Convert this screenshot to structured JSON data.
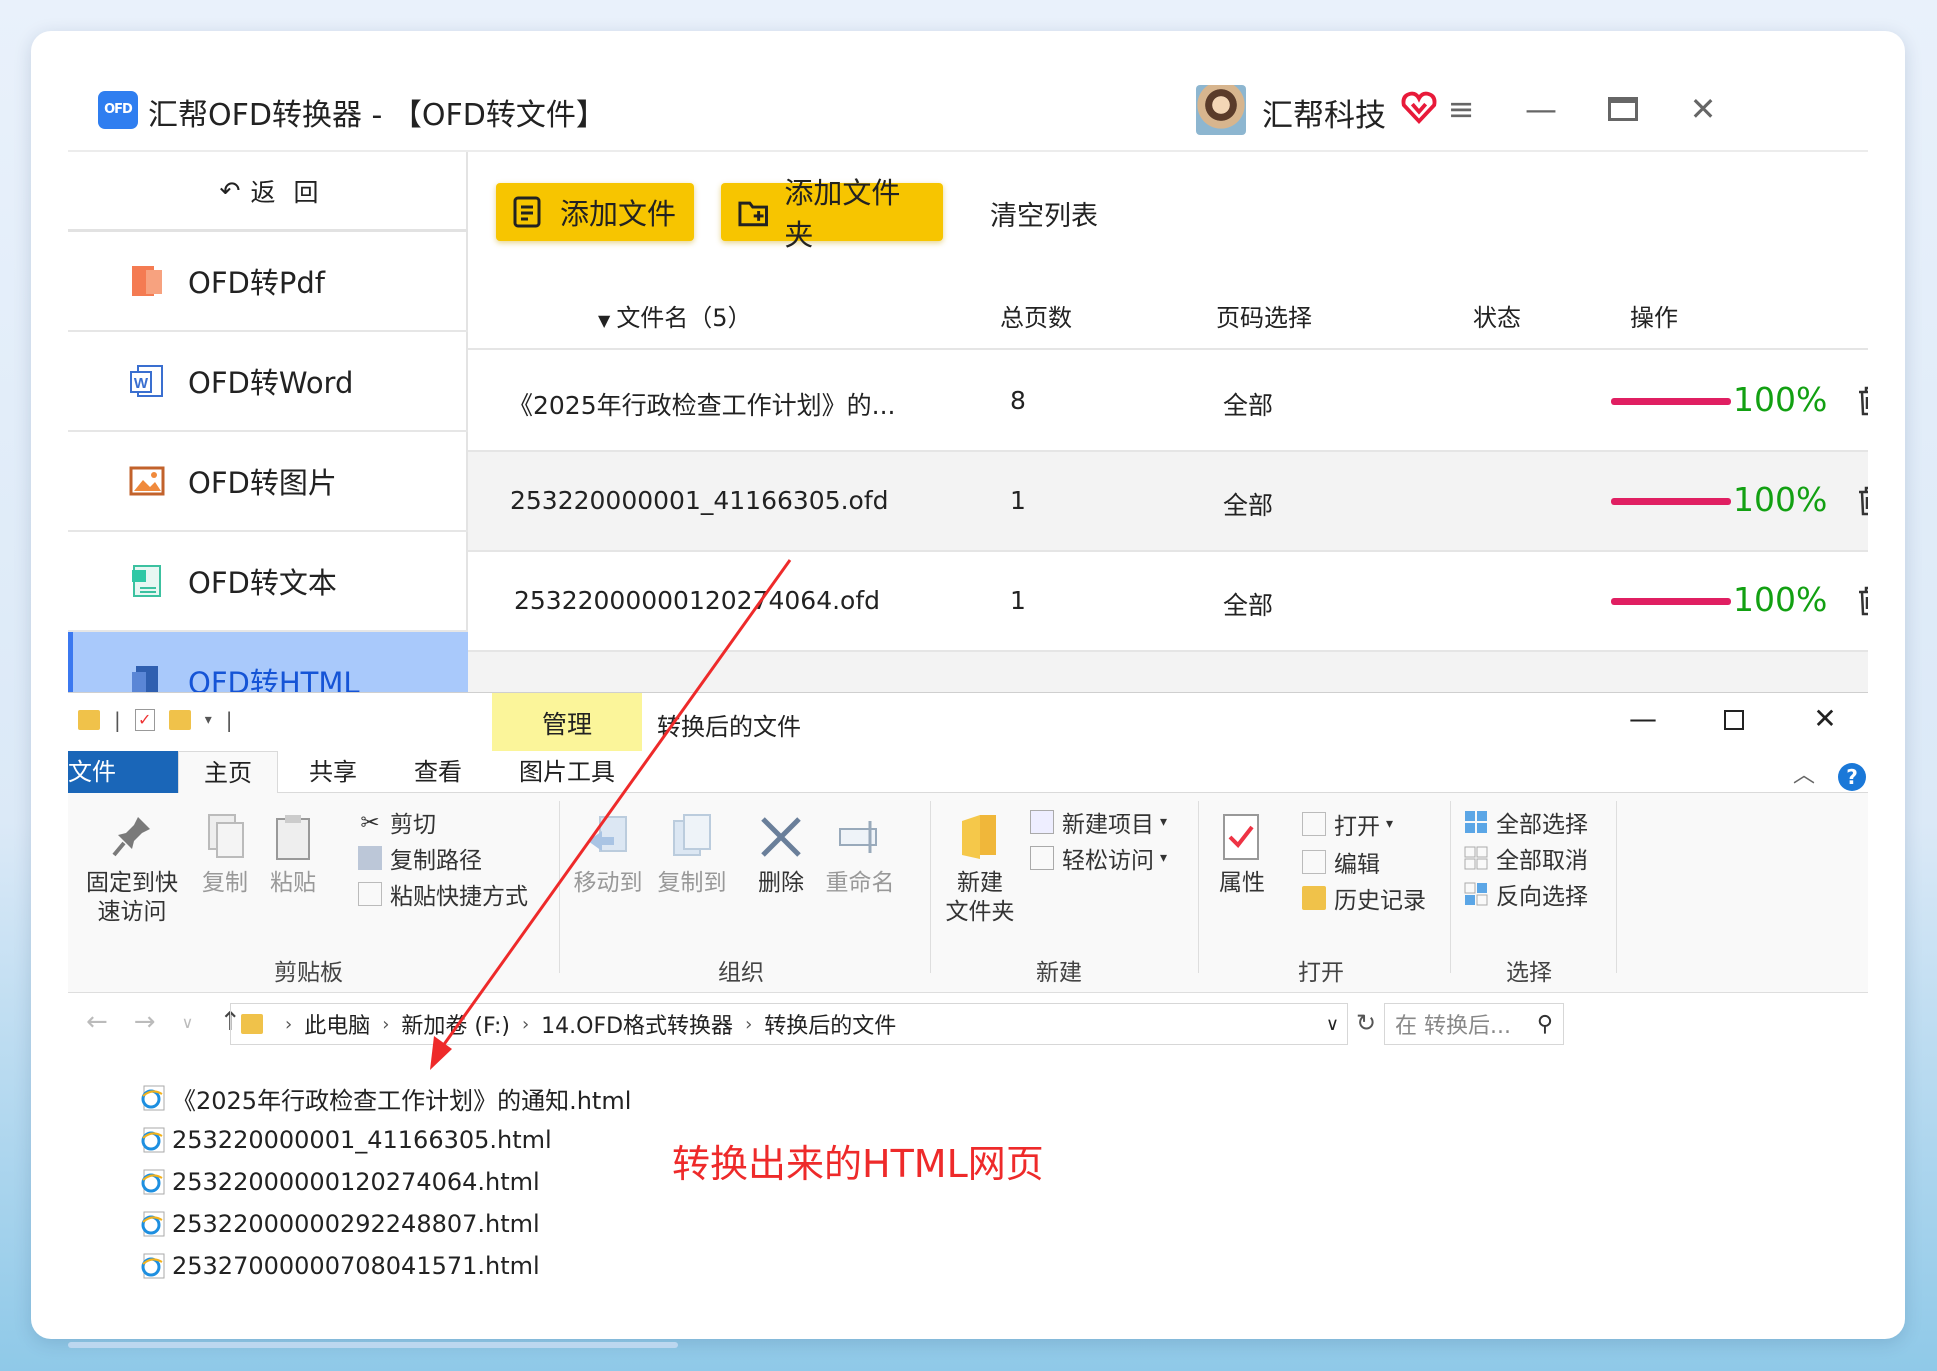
{
  "app": {
    "logo_text": "OFD",
    "title": "汇帮OFD转换器 - 【OFD转文件】",
    "brand": "汇帮科技",
    "window_buttons": [
      "menu-icon",
      "minimize-icon",
      "maximize-icon",
      "close-icon"
    ]
  },
  "sidebar": {
    "back_label": "返回",
    "items": [
      {
        "label": "OFD转Pdf",
        "icon": "pdf-icon"
      },
      {
        "label": "OFD转Word",
        "icon": "word-icon"
      },
      {
        "label": "OFD转图片",
        "icon": "image-icon"
      },
      {
        "label": "OFD转文本",
        "icon": "text-icon"
      },
      {
        "label": "OFD转HTML",
        "icon": "html-icon",
        "active": true
      }
    ]
  },
  "toolbar": {
    "add_file": "添加文件",
    "add_folder": "添加文件夹",
    "clear_list": "清空列表"
  },
  "table": {
    "headers": {
      "filename": "文件名（5）",
      "pages": "总页数",
      "page_select": "页码选择",
      "status": "状态",
      "action": "操作"
    },
    "rows": [
      {
        "name": "《2025年行政检查工作计划》的...",
        "pages": "8",
        "select": "全部",
        "progress": 100,
        "progress_text": "100%"
      },
      {
        "name": "253220000001_41166305.ofd",
        "pages": "1",
        "select": "全部",
        "progress": 100,
        "progress_text": "100%"
      },
      {
        "name": "25322000000120274064.ofd",
        "pages": "1",
        "select": "全部",
        "progress": 100,
        "progress_text": "100%"
      }
    ]
  },
  "explorer": {
    "manage_tab": "管理",
    "title": "转换后的文件",
    "tabs": [
      "文件",
      "主页",
      "共享",
      "查看",
      "图片工具"
    ],
    "ribbon": {
      "clipboard": {
        "pin": "固定到快\n速访问",
        "copy": "复制",
        "paste": "粘贴",
        "cut": "剪切",
        "copy_path": "复制路径",
        "paste_shortcut": "粘贴快捷方式",
        "label": "剪贴板"
      },
      "organize": {
        "move_to": "移动到",
        "copy_to": "复制到",
        "delete": "删除",
        "rename": "重命名",
        "label": "组织"
      },
      "new": {
        "new_folder": "新建\n文件夹",
        "new_item": "新建项目",
        "easy_access": "轻松访问",
        "label": "新建"
      },
      "open": {
        "properties": "属性",
        "open": "打开",
        "edit": "编辑",
        "history": "历史记录",
        "label": "打开"
      },
      "select": {
        "select_all": "全部选择",
        "select_none": "全部取消",
        "invert": "反向选择",
        "label": "选择"
      }
    },
    "address": [
      "此电脑",
      "新加卷 (F:)",
      "14.OFD格式转换器",
      "转换后的文件"
    ],
    "search_placeholder": "在 转换后...",
    "files": [
      "《2025年行政检查工作计划》的通知.html",
      "253220000001_41166305.html",
      "25322000000120274064.html",
      "25322000000292248807.html",
      "25327000000708041571.html"
    ]
  },
  "annotation": "转换出来的HTML网页",
  "colors": {
    "accent_yellow": "#f7c500",
    "active_nav": "#a9c9fb",
    "progress": "#e01f62",
    "percent": "#12a012",
    "annotation": "#ee2a2a",
    "file_tab": "#1a66b8"
  }
}
